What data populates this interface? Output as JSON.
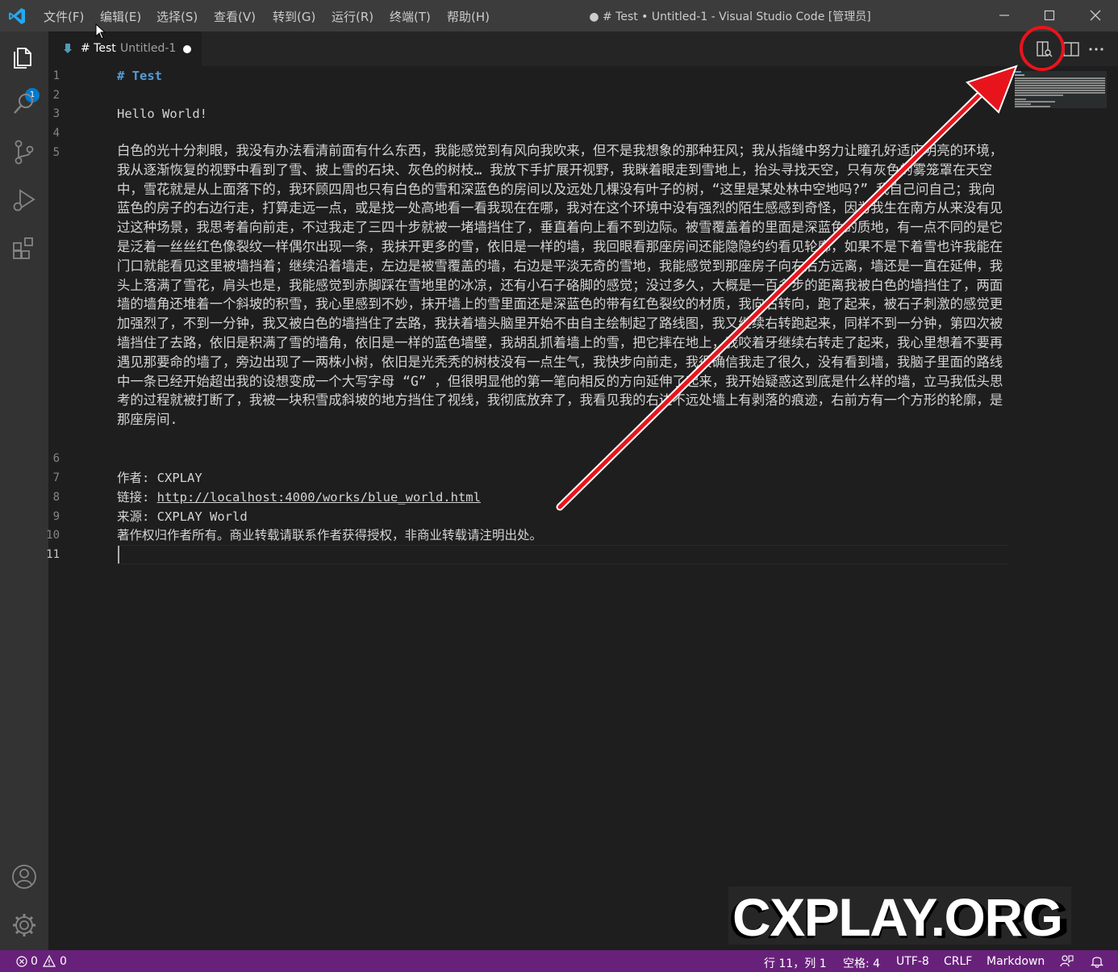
{
  "titlebar": {
    "menu": [
      "文件(F)",
      "编辑(E)",
      "选择(S)",
      "查看(V)",
      "转到(G)",
      "运行(R)",
      "终端(T)",
      "帮助(H)"
    ],
    "window_title": "● # Test • Untitled-1 - Visual Studio Code [管理员]",
    "controls": [
      "minimize-icon",
      "maximize-icon",
      "close-icon"
    ]
  },
  "activitybar": {
    "top_icons": [
      "files-icon",
      "search-icon",
      "source-control-icon",
      "run-debug-icon",
      "extensions-icon"
    ],
    "explorer_badge": "1",
    "bottom_icons": [
      "account-icon",
      "settings-gear-icon"
    ]
  },
  "tab": {
    "title": "# Test",
    "description": "Untitled-1",
    "dirty": true
  },
  "editor_actions": [
    "open-preview-to-side-icon",
    "split-editor-icon",
    "more-actions-icon"
  ],
  "editor": {
    "line_numbers": [
      "1",
      "2",
      "3",
      "4",
      "5",
      "6",
      "7",
      "8",
      "9",
      "10",
      "11"
    ],
    "active_line": "11",
    "line1": "# Test",
    "line3": "Hello World!",
    "paragraph": "白色的光十分刺眼，我没有办法看清前面有什么东西，我能感觉到有风向我吹来，但不是我想象的那种狂风；我从指缝中努力让瞳孔好适应明亮的环境，我从逐渐恢复的视野中看到了雪、披上雪的石块、灰色的树枝… 我放下手扩展开视野，我眯着眼走到雪地上，抬头寻找天空，只有灰色的雾笼罩在天空中，雪花就是从上面落下的，我环顾四周也只有白色的雪和深蓝色的房间以及远处几棵没有叶子的树，“这里是某处林中空地吗?” 我自己问自己；我向蓝色的房子的右边行走，打算走远一点，或是找一处高地看一看我现在在哪，我对在这个环境中没有强烈的陌生感感到奇怪，因为我生在南方从来没有见过这种场景，我思考着向前走，不过我走了三四十步就被一堵墙挡住了，垂直着向上看不到边际。被雪覆盖着的里面是深蓝色的质地，有一点不同的是它是泛着一丝丝红色像裂纹一样偶尔出现一条，我抹开更多的雪，依旧是一样的墙，我回眼看那座房间还能隐隐约约看见轮廓，如果不是下着雪也许我能在门口就能看见这里被墙挡着；继续沿着墙走，左边是被雪覆盖的墙，右边是平淡无奇的雪地，我能感觉到那座房子向右后方远离，墙还是一直在延伸，我头上落满了雪花，肩头也是，我能感觉到赤脚踩在雪地里的冰凉，还有小石子硌脚的感觉；没过多久，大概是一百多步的距离我被白色的墙挡住了，两面墙的墙角还堆着一个斜坡的积雪，我心里感到不妙，抹开墙上的雪里面还是深蓝色的带有红色裂纹的材质，我向右转向，跑了起来，被石子刺激的感觉更加强烈了，不到一分钟，我又被白色的墙挡住了去路，我扶着墙头脑里开始不由自主绘制起了路线图，我又继续右转跑起来，同样不到一分钟，第四次被墙挡住了去路，依旧是积满了雪的墙角，依旧是一样的蓝色墙壁，我胡乱抓着墙上的雪，把它摔在地上，我咬着牙继续右转走了起来，我心里想着不要再遇见那要命的墙了，旁边出现了一两株小树，依旧是光秃秃的树枝没有一点生气，我快步向前走，我很确信我走了很久，没有看到墙，我脑子里面的路线中一条已经开始超出我的设想变成一个大写字母 “G” ，但很明显他的第一笔向相反的方向延伸了起来，我开始疑惑这到底是什么样的墙，立马我低头思考的过程就被打断了，我被一块积雪成斜坡的地方挡住了视线，我彻底放弃了，我看见我的右边不远处墙上有剥落的痕迹，右前方有一个方形的轮廓，是那座房间.",
    "line7": "作者: CXPLAY",
    "line8_prefix": "链接: ",
    "line8_link": "http://localhost:4000/works/blue_world.html",
    "line9": "来源: CXPLAY World",
    "line10": "著作权归作者所有。商业转载请联系作者获得授权，非商业转载请注明出处。"
  },
  "statusbar": {
    "errors": "0",
    "warnings": "0",
    "position": "行 11，列 1",
    "indent": "空格: 4",
    "encoding": "UTF-8",
    "eol": "CRLF",
    "language": "Markdown",
    "icons": [
      "error-icon",
      "warning-icon",
      "feedback-icon",
      "bell-icon"
    ]
  },
  "colors": {
    "statusbar": "#68217a",
    "titlebar": "#3c3c3c",
    "activitybar": "#333333",
    "editor": "#1e1e1e",
    "accent": "#007acc",
    "annotation": "#e8141c"
  },
  "overlay": {
    "watermark": "CXPLAY.ORG"
  }
}
